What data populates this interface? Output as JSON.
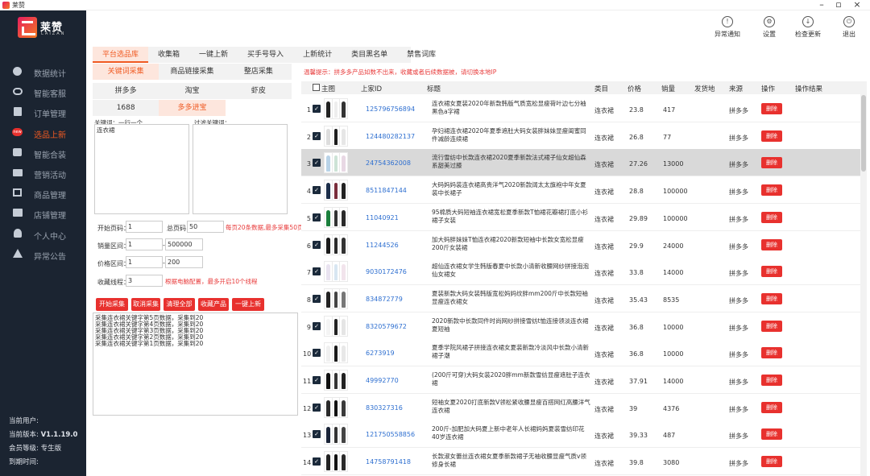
{
  "window": {
    "title": "莱赞"
  },
  "brand": {
    "name": "莱赞",
    "sub": "LAIZAN"
  },
  "nav": [
    {
      "label": "数据统计",
      "icon": "pie-chart-icon"
    },
    {
      "label": "智能客服",
      "icon": "chat-bubble-icon"
    },
    {
      "label": "订单管理",
      "icon": "order-list-icon"
    },
    {
      "label": "选品上新",
      "icon": "new-badge-icon"
    },
    {
      "label": "智能合装",
      "icon": "bag-icon"
    },
    {
      "label": "营销活动",
      "icon": "marketing-icon"
    },
    {
      "label": "商品管理",
      "icon": "goods-icon"
    },
    {
      "label": "店铺管理",
      "icon": "store-icon"
    },
    {
      "label": "个人中心",
      "icon": "user-icon"
    },
    {
      "label": "异常公告",
      "icon": "warning-icon"
    }
  ],
  "nav_active_index": 3,
  "side_info": {
    "user_label": "当前用户:",
    "version_label": "当前版本:",
    "version": "V1.1.19.0",
    "level_label": "会员等级:",
    "level": "专生版",
    "expire_label": "到期时间:"
  },
  "toolbar": [
    {
      "label": "异常通知",
      "icon": "warning-triangle-icon",
      "glyph": "!"
    },
    {
      "label": "设置",
      "icon": "settings-gear-icon",
      "glyph": "⚙"
    },
    {
      "label": "检查更新",
      "icon": "download-icon",
      "glyph": "↓"
    },
    {
      "label": "退出",
      "icon": "power-icon",
      "glyph": "⏻"
    }
  ],
  "main_tabs": [
    "平台选品库",
    "收集箱",
    "一键上新",
    "买手号导入",
    "上新统计",
    "类目黑名单",
    "禁售词库"
  ],
  "sub_tabs_row1": [
    "关键词采集",
    "商品链接采集",
    "整店采集"
  ],
  "sub_tabs_row2": [
    "拼多多",
    "淘宝",
    "虾皮"
  ],
  "sub_tabs_row3": [
    "1688",
    "多多进宝"
  ],
  "keywords": {
    "label": "关键词：一行一个",
    "value": "连衣裙",
    "filter_label": "过滤关键词："
  },
  "form": {
    "start_page_label": "开始页码：",
    "start_page": "1",
    "total_page_label": "总页码：",
    "total_page": "50",
    "page_hint": "每页20条数据,最多采集50页",
    "sales_label": "销量区间：",
    "sales_min": "1",
    "sales_max": "500000",
    "price_label": "价格区间：",
    "price_min": "1",
    "price_max": "200",
    "thread_label": "收藏线程：",
    "thread": "3",
    "thread_hint": "根据电脑配置，最多开启10个线程",
    "range_sep": "--"
  },
  "actions": [
    "开始采集",
    "取消采集",
    "清理全部",
    "收藏产品",
    "一键上新"
  ],
  "log": [
    "采集连衣裙关键字第5页数据，采集到20",
    "采集连衣裙关键字第4页数据，采集到20",
    "采集连衣裙关键字第3页数据，采集到20",
    "采集连衣裙关键字第2页数据，采集到20",
    "采集连衣裙关键字第1页数据，采集到20"
  ],
  "notice": "温馨提示：拼多多产品如数不出来，收藏或者后续数据被，请切换本地IP",
  "table": {
    "headers": {
      "select": "主图",
      "id": "上家ID",
      "title": "标题",
      "category": "类目",
      "price": "价格",
      "sales": "销量",
      "ship": "发货地",
      "source": "来源",
      "op": "操作",
      "result": "操作结果"
    },
    "delete_label": "删除",
    "selected_row": 2,
    "rows": [
      {
        "idx": "1",
        "id": "125796756894",
        "title": "连衣裙女夏装2020年新款韩版气质宽松显瘦荷叶边七分袖黑色a字裙",
        "cat": "连衣裙",
        "price": "23.8",
        "sales": "417",
        "src": "拼多多"
      },
      {
        "idx": "2",
        "id": "124480282137",
        "title": "孕妇裙连衣裙2020年夏季遮肚大码女装胖妹妹显瘦闺蜜同件减龄连续裙",
        "cat": "连衣裙",
        "price": "26.8",
        "sales": "77",
        "src": "拼多多"
      },
      {
        "idx": "3",
        "id": "24754362008",
        "title": "流行雪纺中长款连衣裙2020夏季新款法式裙子仙女超仙森系甜美过膝",
        "cat": "连衣裙",
        "price": "27.26",
        "sales": "13000",
        "src": "拼多多"
      },
      {
        "idx": "4",
        "id": "8511847144",
        "title": "大码妈妈装连衣裙高贵洋气2020新款阔太太旗袍中年女夏装中长裙子",
        "cat": "连衣裙",
        "price": "28.8",
        "sales": "100000",
        "src": "拼多多"
      },
      {
        "idx": "5",
        "id": "11040921",
        "title": "95棉质大码短袖连衣裙宽松夏季新款T恤裙花瓣裙打底小衫裙子女装",
        "cat": "连衣裙",
        "price": "29.89",
        "sales": "100000",
        "src": "拼多多"
      },
      {
        "idx": "6",
        "id": "11244526",
        "title": "加大码胖妹妹T恤连衣裙2020新款短袖中长款女宽松显瘦200斤女装裙",
        "cat": "连衣裙",
        "price": "29.9",
        "sales": "24000",
        "src": "拼多多"
      },
      {
        "idx": "7",
        "id": "9030172476",
        "title": "超仙连衣裙女学生韩版春夏中长款小清新收腰网纱拼接泡泡仙女裙女",
        "cat": "连衣裙",
        "price": "33.8",
        "sales": "14000",
        "src": "拼多多"
      },
      {
        "idx": "8",
        "id": "834872779",
        "title": "夏装新款大码女装韩版宽松妈妈纹胖mm200斤中长款短袖显瘦连衣裙女",
        "cat": "连衣裙",
        "price": "35.43",
        "sales": "8535",
        "src": "拼多多"
      },
      {
        "idx": "9",
        "id": "8320579672",
        "title": "2020新款中长款同件时尚网纱拼接雪纺t恤连接领淡连衣裙夏短袖",
        "cat": "连衣裙",
        "price": "36.8",
        "sales": "10000",
        "src": "拼多多"
      },
      {
        "idx": "10",
        "id": "6273919",
        "title": "夏季学院风裙子拼接连衣裙女夏装新款冷淡风中长款小清新裙子潮",
        "cat": "连衣裙",
        "price": "36.8",
        "sales": "10000",
        "src": "拼多多"
      },
      {
        "idx": "11",
        "id": "49992770",
        "title": "(200斤可穿)大码女装2020胖mm新款雪纺显瘦遮肚子连衣裙",
        "cat": "连衣裙",
        "price": "37.91",
        "sales": "14000",
        "src": "拼多多"
      },
      {
        "idx": "12",
        "id": "830327316",
        "title": "短袖女夏2020打底新款V领松紧收腰显瘦百搭网红高腰洋气连衣裙",
        "cat": "连衣裙",
        "price": "39",
        "sales": "4376",
        "src": "拼多多"
      },
      {
        "idx": "13",
        "id": "121750558856",
        "title": "200斤-加肥加大码夏上新中老年人长裙妈妈夏装雪纺印花40岁连衣裙",
        "cat": "连衣裙",
        "price": "39.33",
        "sales": "487",
        "src": "拼多多"
      },
      {
        "idx": "14",
        "id": "14758791418",
        "title": "长款淑女蕾丝连衣裙女夏季新款裙子无袖收腰显瘦气质v领修身长裙",
        "cat": "连衣裙",
        "price": "39.8",
        "sales": "3080",
        "src": "拼多多"
      }
    ]
  },
  "colors": {
    "sidebar_bg": "#1b2431",
    "accent": "#f05a22",
    "danger": "#e8312e",
    "link": "#2e6fd0"
  }
}
